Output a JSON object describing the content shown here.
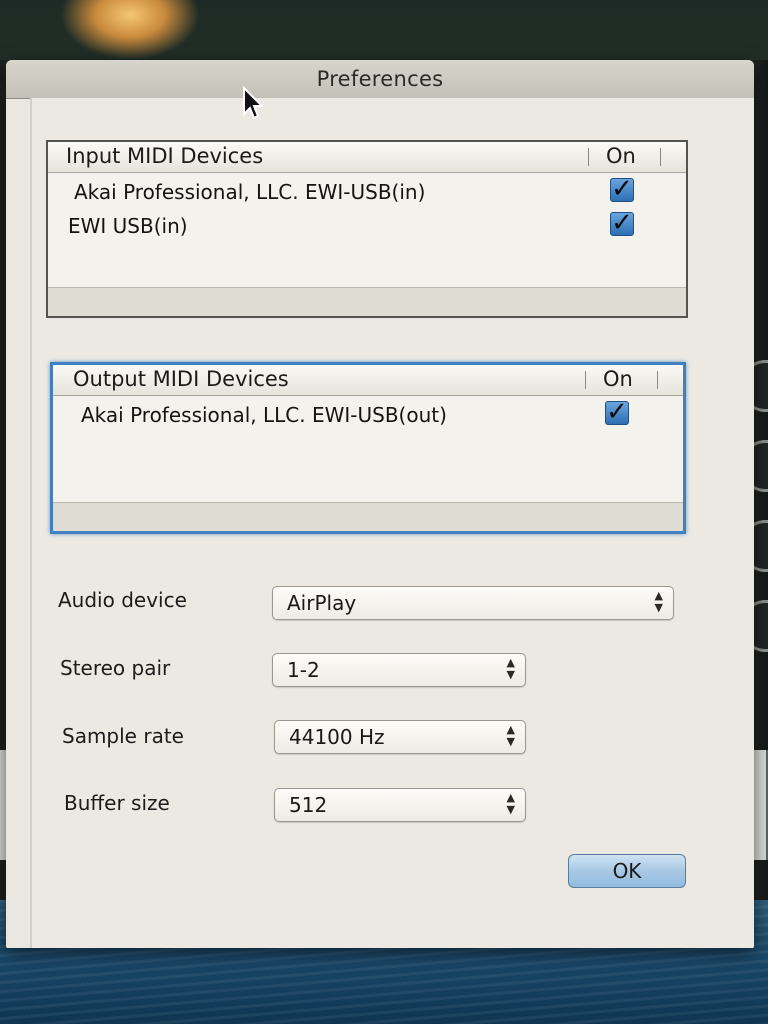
{
  "window": {
    "title": "Preferences"
  },
  "input_list": {
    "col_name": "Input MIDI Devices",
    "col_on": "On",
    "rows": [
      {
        "label": "Akai Professional, LLC. EWI-USB(in)",
        "checked": true
      },
      {
        "label": "EWI USB(in)",
        "checked": true
      }
    ]
  },
  "output_list": {
    "col_name": "Output MIDI Devices",
    "col_on": "On",
    "rows": [
      {
        "label": "Akai Professional, LLC. EWI-USB(out)",
        "checked": true
      }
    ]
  },
  "settings": {
    "audio_device": {
      "label": "Audio device",
      "value": "AirPlay"
    },
    "stereo_pair": {
      "label": "Stereo pair",
      "value": "1-2"
    },
    "sample_rate": {
      "label": "Sample rate",
      "value": "44100 Hz"
    },
    "buffer_size": {
      "label": "Buffer size",
      "value": "512"
    }
  },
  "buttons": {
    "ok": "OK"
  },
  "icons": {
    "check": "checkbox-checked-icon",
    "popup": "updown-arrows-icon",
    "cursor": "mouse-pointer-icon"
  },
  "colors": {
    "accent": "#3f7fc2",
    "checkbox": "#2e6fb3",
    "ok_button": "#a7c8e4"
  }
}
